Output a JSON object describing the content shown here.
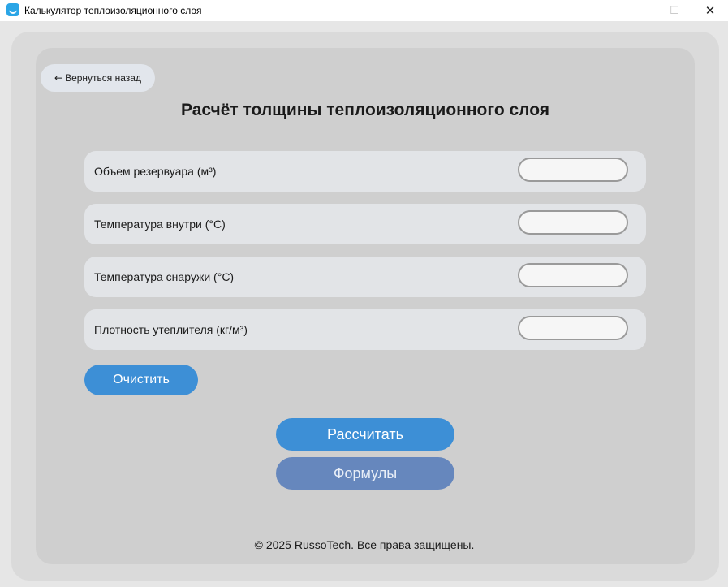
{
  "window": {
    "title": "Калькулятор теплоизоляционного слоя",
    "minimize_glyph": "—",
    "maximize_glyph": "☐",
    "close_glyph": "✕"
  },
  "header": {
    "back_arrow": "←",
    "back_label": "Вернуться назад",
    "title": "Расчёт толщины теплоизоляционного слоя"
  },
  "form": {
    "fields": [
      {
        "label": "Объем резервуара (м³)",
        "value": ""
      },
      {
        "label": "Температура внутри (°С)",
        "value": ""
      },
      {
        "label": "Температура снаружи (°С)",
        "value": ""
      },
      {
        "label": "Плотность утеплителя (кг/м³)",
        "value": ""
      }
    ],
    "clear_label": "Очистить"
  },
  "actions": {
    "calculate_label": "Рассчитать",
    "formulas_label": "Формулы"
  },
  "footer": {
    "copyright": "© 2025 RussoTech. Все права защищены."
  },
  "colors": {
    "primary": "#3d8fd6",
    "secondary": "#6687bd",
    "card_outer": "#dadada",
    "card_inner": "#cfcfcf",
    "field_bg": "#e2e4e7"
  },
  "icons": {
    "app": "app-icon",
    "back": "arrow-left-icon"
  }
}
